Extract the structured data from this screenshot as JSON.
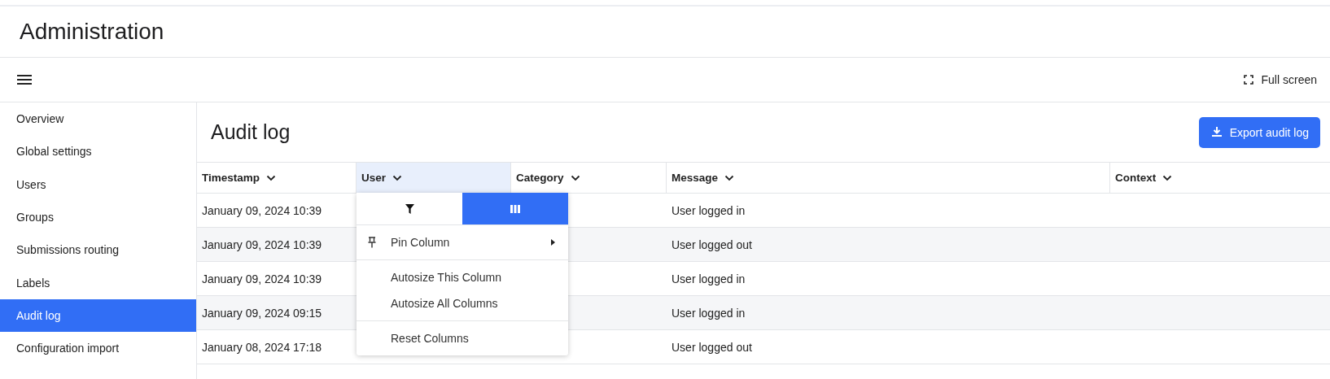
{
  "header": {
    "title": "Administration"
  },
  "toolbar": {
    "fullscreen_label": "Full screen"
  },
  "sidebar": {
    "items": [
      {
        "label": "Overview",
        "selected": false
      },
      {
        "label": "Global settings",
        "selected": false
      },
      {
        "label": "Users",
        "selected": false
      },
      {
        "label": "Groups",
        "selected": false
      },
      {
        "label": "Submissions routing",
        "selected": false
      },
      {
        "label": "Labels",
        "selected": false
      },
      {
        "label": "Audit log",
        "selected": true
      },
      {
        "label": "Configuration import",
        "selected": false
      }
    ]
  },
  "page": {
    "title": "Audit log",
    "export_button": "Export audit log"
  },
  "table": {
    "columns": [
      {
        "label": "Timestamp",
        "highlighted": false
      },
      {
        "label": "User",
        "highlighted": true
      },
      {
        "label": "Category",
        "highlighted": false
      },
      {
        "label": "Message",
        "highlighted": false
      },
      {
        "label": "Context",
        "highlighted": false
      }
    ],
    "rows": [
      {
        "timestamp": "January 09, 2024 10:39",
        "message": "User logged in"
      },
      {
        "timestamp": "January 09, 2024 10:39",
        "message": "User logged out"
      },
      {
        "timestamp": "January 09, 2024 10:39",
        "message": "User logged in"
      },
      {
        "timestamp": "January 09, 2024 09:15",
        "message": "User logged in"
      },
      {
        "timestamp": "January 08, 2024 17:18",
        "message": "User logged out"
      }
    ]
  },
  "column_menu": {
    "tabs": [
      {
        "kind": "filter",
        "selected": false
      },
      {
        "kind": "columns",
        "selected": true
      }
    ],
    "sections": [
      [
        {
          "label": "Pin Column",
          "kind": "pin"
        }
      ],
      [
        {
          "label": "Autosize This Column",
          "kind": "plain"
        },
        {
          "label": "Autosize All Columns",
          "kind": "plain"
        }
      ],
      [
        {
          "label": "Reset Columns",
          "kind": "plain"
        }
      ]
    ]
  }
}
